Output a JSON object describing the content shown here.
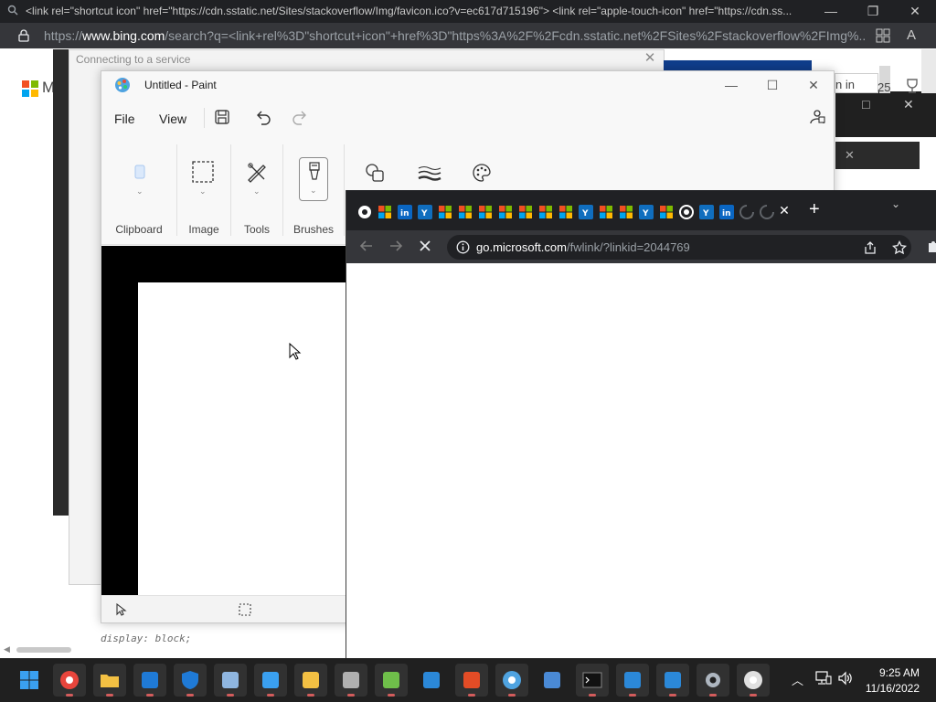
{
  "background_browser": {
    "title": "<link rel=\"shortcut icon\" href=\"https://cdn.sstatic.net/Sites/stackoverflow/Img/favicon.ico?v=ec617d715196\"> <link rel=\"apple-touch-icon\" href=\"https://cdn.ss...",
    "url_prefix": "https://",
    "url_domain": "www.bing.com",
    "url_rest": "/search?q=<link+rel%3D\"shortcut+icon\"+href%3D\"https%3A%2F%2Fcdn.sstatic.net%2FSites%2Fstackoverflow%2FImg%...",
    "page_code_snippet": "display: block;",
    "bing_signin_fragment": "n in",
    "bing_points_fragment": "25",
    "logo_letter": "M"
  },
  "connect_dialog": {
    "title": "Connecting to a service"
  },
  "paint": {
    "title": "Untitled - Paint",
    "menu": {
      "file": "File",
      "view": "View"
    },
    "ribbon": {
      "clipboard": "Clipboard",
      "image": "Image",
      "tools": "Tools",
      "brushes": "Brushes"
    }
  },
  "chrome": {
    "url_domain": "go.microsoft.com",
    "url_path": "/fwlink/?linkid=2044769"
  },
  "taskbar": {
    "time": "9:25 AM",
    "date": "11/16/2022"
  },
  "colors": {
    "taskbar_bg": "#202020",
    "chrome_dark": "#202124",
    "accent_blue": "#0f3d8c"
  }
}
